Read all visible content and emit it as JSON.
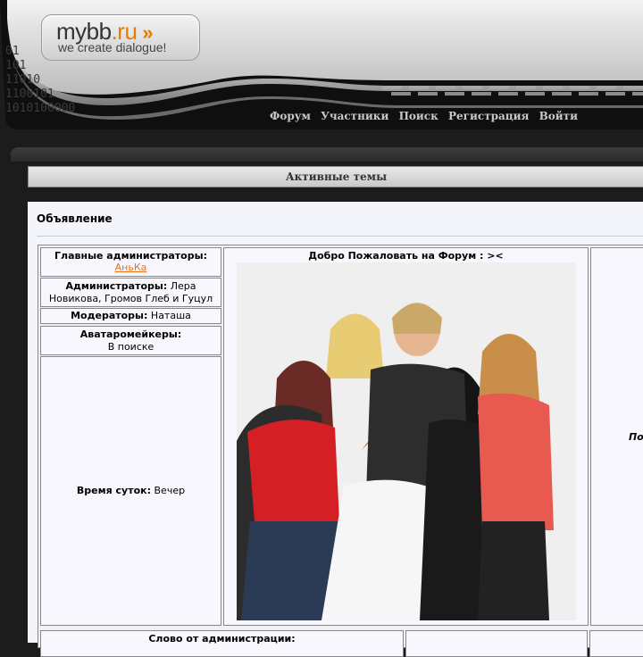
{
  "logo": {
    "brand_main": "mybb",
    "brand_tld": ".ru",
    "arrows": "»",
    "tagline": "we create dialogue!"
  },
  "binary_text": "01\n101\n11010\n1100101\n1010100000",
  "nav": {
    "forum": "Форум",
    "members": "Участники",
    "search": "Поиск",
    "register": "Регистрация",
    "login": "Войти"
  },
  "active_topics": "Активные темы",
  "announcement": {
    "title": "Объявление",
    "head_admins_label": "Главные администраторы:",
    "head_admins_value": "АньКа",
    "admins_label": "Администраторы:",
    "admins_value": "Лера Новикова, Громов Глеб и Гуцул",
    "moderators_label": "Модераторы:",
    "moderators_value": "Наташа",
    "avatar_makers_label": "Аватаромейкеры:",
    "avatar_makers_value": "В поиске",
    "time_label": "Время суток:",
    "time_value": "Вечер",
    "welcome": "Добро Пожаловать на Форум : ><",
    "right_partial": "По",
    "admin_word": "Слово от администрации:"
  }
}
